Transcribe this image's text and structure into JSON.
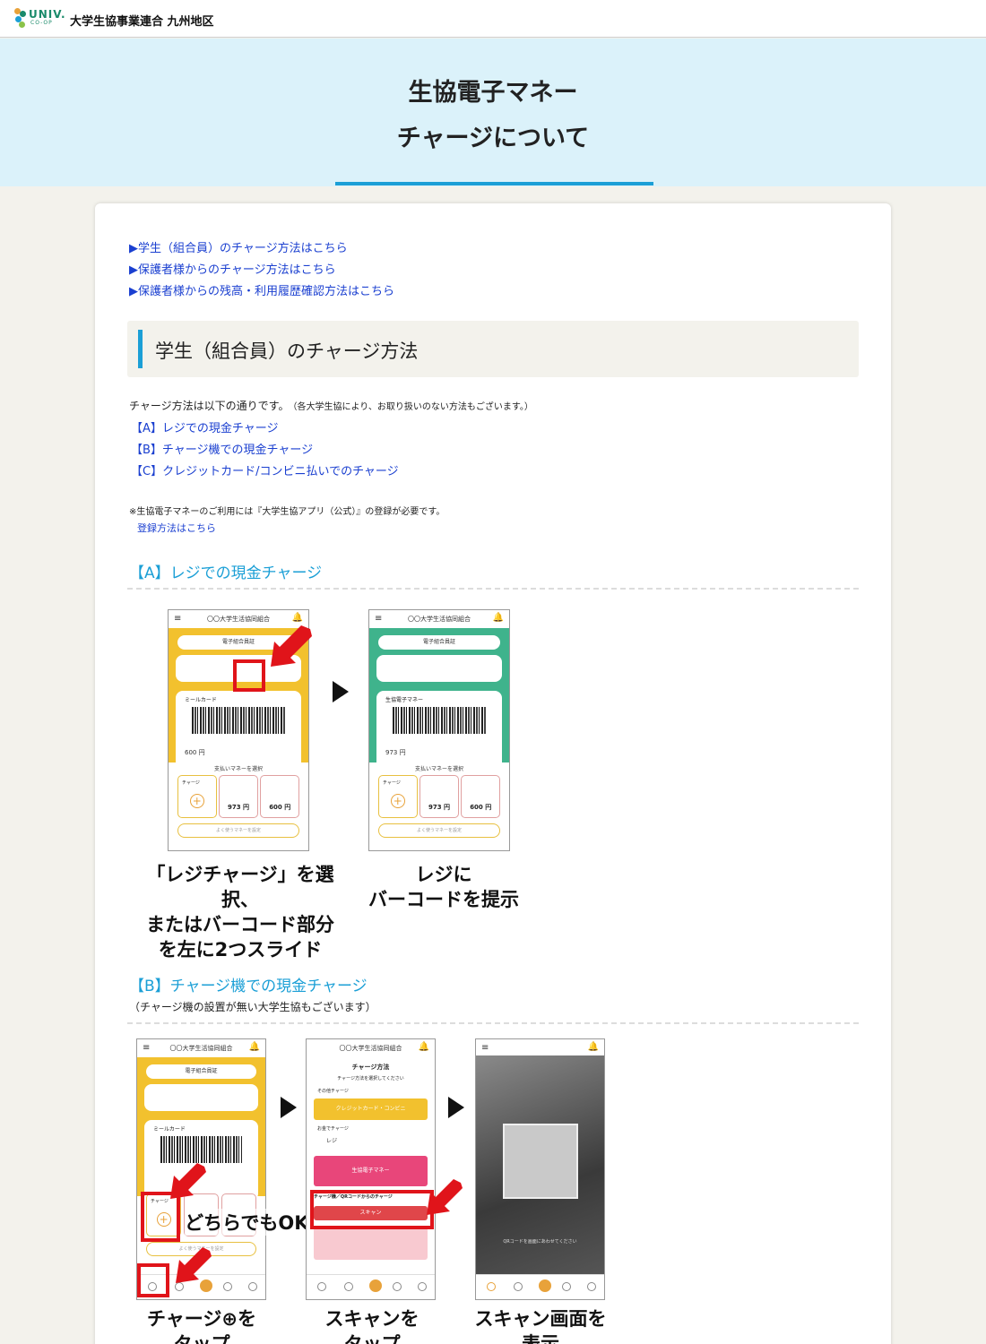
{
  "header": {
    "logo_text": "UNIV.",
    "logo_sub": "CO-OP",
    "site_name": "大学生協事業連合 九州地区"
  },
  "hero": {
    "title_line1": "生協電子マネー",
    "title_line2": "チャージについて"
  },
  "toc": [
    "▶学生（組合員）のチャージ方法はこちら",
    "▶保護者様からのチャージ方法はこちら",
    "▶保護者様からの残高・利用履歴確認方法はこちら"
  ],
  "section": {
    "title": "学生（組合員）のチャージ方法",
    "intro": "チャージ方法は以下の通りです。",
    "intro_note": "（各大学生協により、お取り扱いのない方法もございます。）",
    "methods": [
      "【A】レジでの現金チャージ",
      "【B】チャージ機での現金チャージ",
      "【C】クレジットカード/コンビニ払いでのチャージ"
    ],
    "note": "※生協電子マネーのご利用には『大学生協アプリ（公式）』の登録が必要です。",
    "register_link": "登録方法はこちら"
  },
  "method_a": {
    "heading": "【A】レジでの現金チャージ",
    "caption1": "「レジチャージ」を選択、またはバーコード部分を左に2つスライド",
    "caption1_lines": [
      "「レジチャージ」を選択、",
      "またはバーコード部分",
      "を左に2つスライド"
    ],
    "caption2_lines": [
      "レジに",
      "バーコードを提示"
    ]
  },
  "method_b": {
    "heading": "【B】チャージ機での現金チャージ",
    "subnote": "（チャージ機の設置が無い大学生協もございます）",
    "either_ok": "どちらでもOK",
    "caption1_lines": [
      "チャージ⊕を",
      "タップ"
    ],
    "caption2_lines": [
      "スキャンを",
      "タップ"
    ],
    "caption3_lines": [
      "スキャン画面を",
      "表示"
    ]
  },
  "phone": {
    "title": "〇〇大学生活協同組合",
    "member_card": "電子組合員証",
    "meal_card": "ミールカード",
    "emoney": "生協電子マネー",
    "balance_a1": "600 円",
    "balance_a2": "973 円",
    "select_money": "支払いマネーを選択",
    "charge": "チャージ",
    "amt1": "973 円",
    "amt2": "600 円",
    "often_used": "よく使うマネーを設定",
    "charge_method": "チャージ方法",
    "choose_method": "チャージ方法を選択してください",
    "other_charge": "その他チャージ",
    "credit_conv": "クレジットカード・コンビニ",
    "cash_charge": "お金でチャージ",
    "regi": "レジ",
    "machine_qr": "チャージ機／QRコードからのチャージ",
    "scan": "スキャン",
    "scan_hint": "QRコードを画面にあわせてください"
  },
  "colors": {
    "accent_blue": "#1b9fd6",
    "link_blue": "#1a3fd0",
    "app_yellow": "#f2c12e",
    "app_green": "#3fb38c",
    "alert_red": "#e0141a"
  }
}
